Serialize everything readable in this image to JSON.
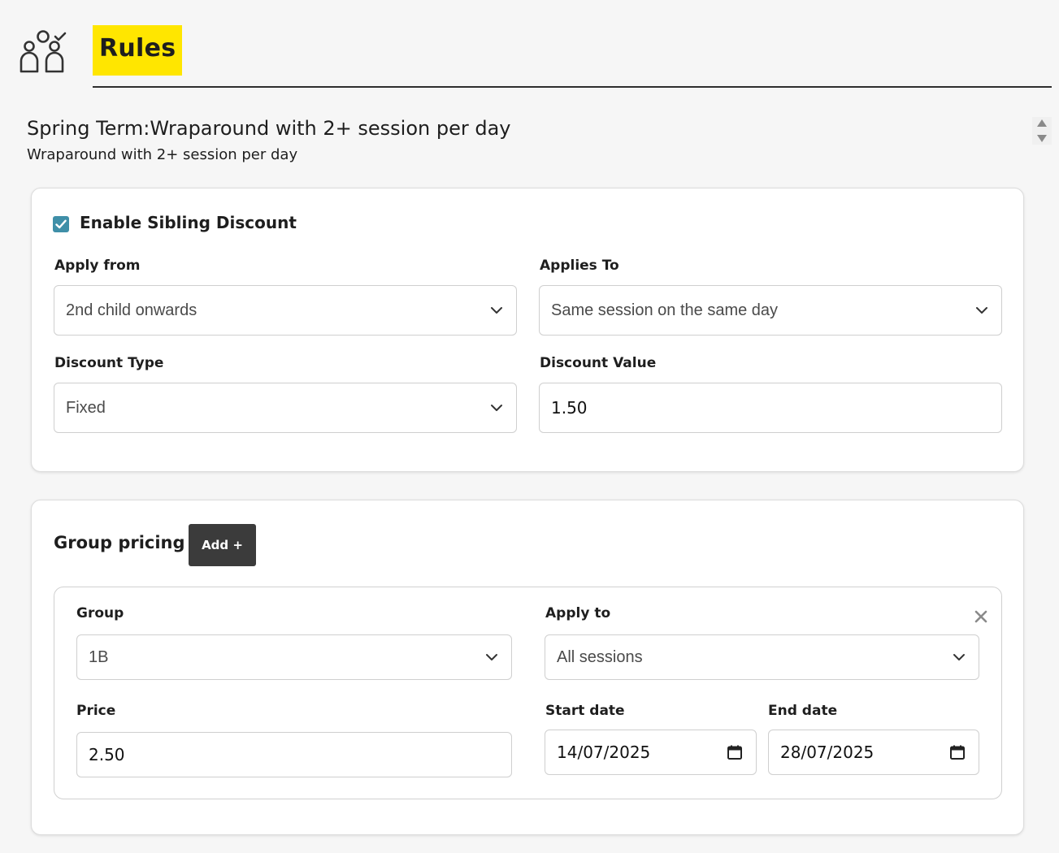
{
  "header": {
    "icon": "people-check-icon",
    "title": "Rules"
  },
  "rule": {
    "title": "Spring Term:Wraparound with 2+ session per day",
    "description": "Wraparound with 2+ session per day"
  },
  "sibling_discount": {
    "checkbox_label": "Enable Sibling Discount",
    "enabled": true,
    "apply_from_label": "Apply from",
    "apply_from_value": "2nd child onwards",
    "applies_to_label": "Applies To",
    "applies_to_value": "Same session on the same day",
    "discount_type_label": "Discount Type",
    "discount_type_value": "Fixed",
    "discount_value_label": "Discount Value",
    "discount_value": "1.50"
  },
  "group_pricing": {
    "title": "Group pricing",
    "add_label": "Add +",
    "entry": {
      "group_label": "Group",
      "group_value": "1B",
      "apply_to_label": "Apply to",
      "apply_to_value": "All sessions",
      "price_label": "Price",
      "price_value": "2.50",
      "start_date_label": "Start date",
      "start_date_value": "14/07/2025",
      "end_date_label": "End date",
      "end_date_value": "28/07/2025"
    }
  },
  "colors": {
    "highlight": "#ffe600",
    "checkbox": "#3f8fa8",
    "button": "#3b3b3b"
  }
}
